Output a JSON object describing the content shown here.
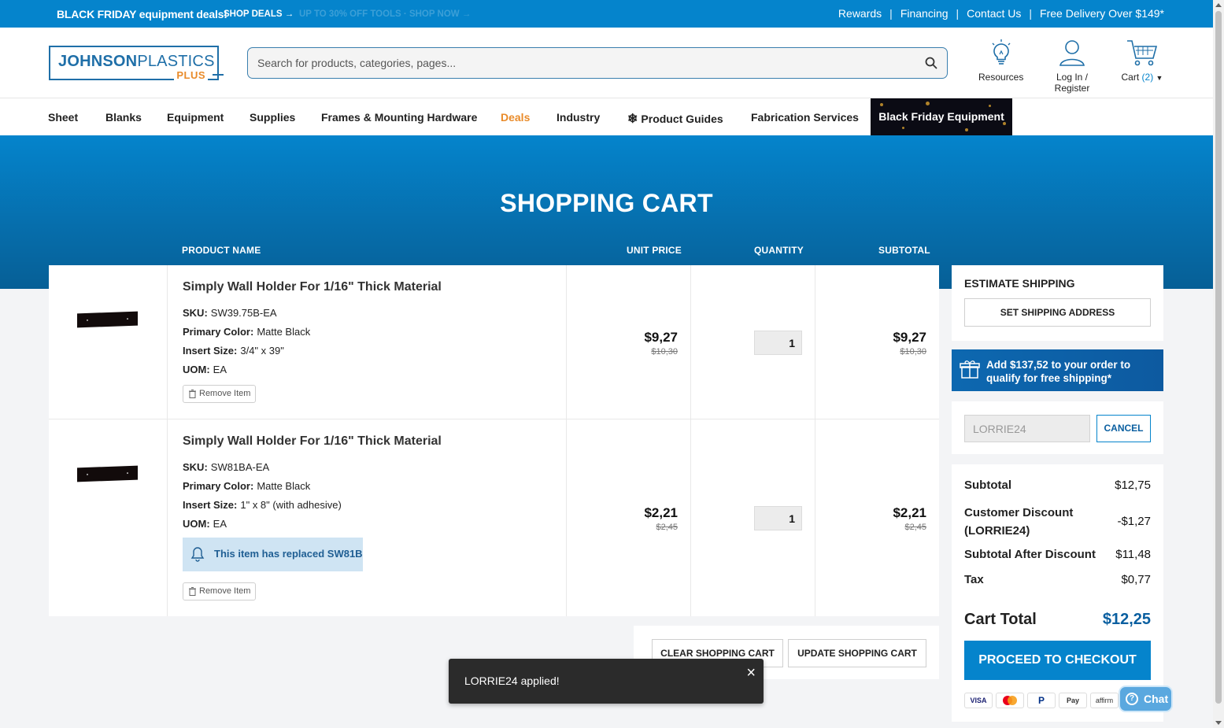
{
  "topbar": {
    "promo": "BLACK FRIDAY equipment deals!",
    "promo_link": "SHOP DEALS →",
    "promo_faded": "UP TO 30% OFF TOOLS · SHOP NOW →",
    "links": [
      "Rewards",
      "Financing",
      "Contact Us",
      "Free Delivery Over $149*"
    ]
  },
  "header": {
    "logo_bold": "JOHNSON",
    "logo_thin": "PLASTICS",
    "logo_sub": "PLUS",
    "search_placeholder": "Search for products, categories, pages...",
    "resources": "Resources",
    "login": "Log In / Register",
    "cart_label": "Cart",
    "cart_count": "(2)"
  },
  "nav": {
    "items": [
      "Sheet",
      "Blanks",
      "Equipment",
      "Supplies",
      "Frames & Mounting Hardware",
      "Deals",
      "Industry",
      "Product Guides",
      "Fabrication Services"
    ],
    "black_friday": "Black Friday Equipment"
  },
  "page": {
    "title": "SHOPPING CART",
    "columns": [
      "PRODUCT NAME",
      "UNIT PRICE",
      "QUANTITY",
      "SUBTOTAL"
    ]
  },
  "cart_items": [
    {
      "name": "Simply Wall Holder For 1/16\" Thick Material",
      "sku_label": "SKU:",
      "sku": "SW39.75B-EA",
      "color_label": "Primary Color:",
      "color": "Matte Black",
      "insert_label": "Insert Size:",
      "insert": "3/4\" x 39\"",
      "uom_label": "UOM:",
      "uom": "EA",
      "unit_price": "$9,27",
      "unit_old": "$10,30",
      "qty": "1",
      "subtotal": "$9,27",
      "subtotal_old": "$10,30",
      "remove": "Remove Item"
    },
    {
      "name": "Simply Wall Holder For 1/16\" Thick Material",
      "sku_label": "SKU:",
      "sku": "SW81BA-EA",
      "color_label": "Primary Color:",
      "color": "Matte Black",
      "insert_label": "Insert Size:",
      "insert": "1\" x 8\" (with adhesive)",
      "uom_label": "UOM:",
      "uom": "EA",
      "replaced_notice": "This item has replaced SW81B",
      "unit_price": "$2,21",
      "unit_old": "$2,45",
      "qty": "1",
      "subtotal": "$2,21",
      "subtotal_old": "$2,45",
      "remove": "Remove Item"
    }
  ],
  "cart_buttons": {
    "clear": "CLEAR SHOPPING CART",
    "update": "UPDATE SHOPPING CART"
  },
  "toast": {
    "message": "LORRIE24 applied!",
    "close": "×"
  },
  "sidebar": {
    "estimate_title": "ESTIMATE SHIPPING",
    "set_address": "SET SHIPPING ADDRESS",
    "free_ship_line1_pre": "Add ",
    "free_ship_amount": "$137,52",
    "free_ship_line1_post": " to your order to",
    "free_ship_line2_pre": "qualify for ",
    "free_ship_free": "free",
    "free_ship_line2_post": " shipping*",
    "coupon_value": "LORRIE24",
    "cancel": "CANCEL",
    "subtotal_label": "Subtotal",
    "subtotal": "$12,75",
    "discount_label_1": "Customer Discount",
    "discount_label_2": "(LORRIE24)",
    "discount": "-$1,27",
    "after_label": "Subtotal After Discount",
    "after": "$11,48",
    "tax_label": "Tax",
    "tax": "$0,77",
    "total_label": "Cart Total",
    "total": "$12,25",
    "checkout": "PROCEED TO CHECKOUT",
    "payments": [
      "VISA",
      "MC",
      "PayPal",
      "Pay",
      "affirm"
    ]
  },
  "chat": {
    "label": "Chat"
  },
  "colors": {
    "primary": "#0584cc",
    "accent": "#e98b2a",
    "dark": "#2b2b2b"
  }
}
